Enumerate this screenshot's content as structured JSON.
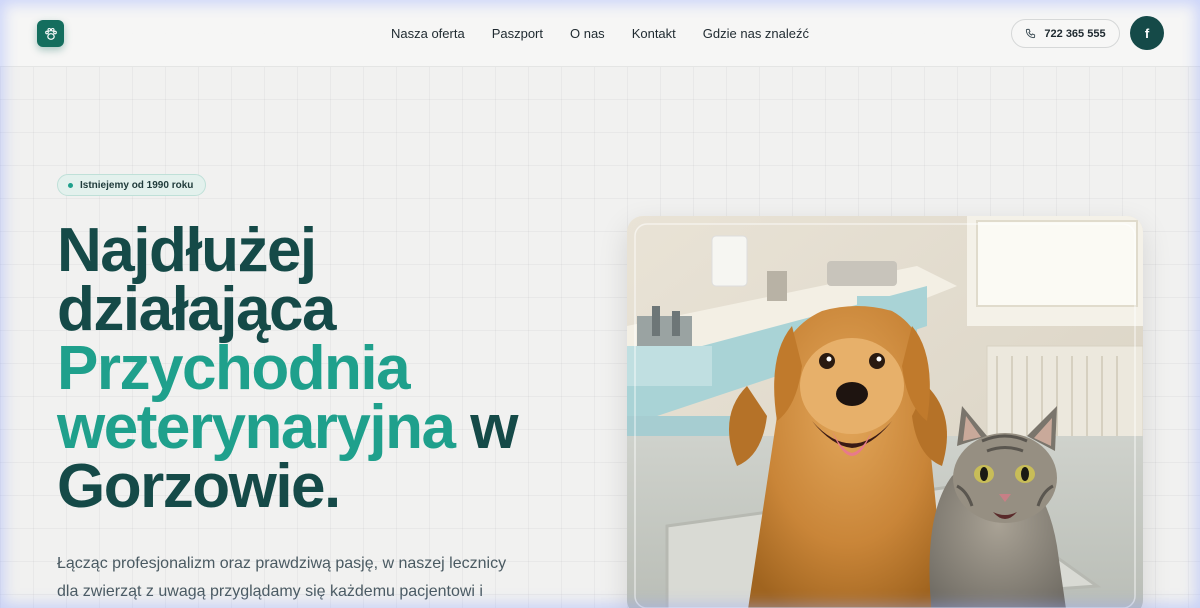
{
  "header": {
    "nav": [
      "Nasza oferta",
      "Paszport",
      "O nas",
      "Kontakt",
      "Gdzie nas znaleźć"
    ],
    "phone": "722 365 555",
    "facebook_icon": "f"
  },
  "hero": {
    "badge": "Istniejemy od 1990 roku",
    "title_part1": "Najdłużej działająca",
    "title_accent": "Przychodnia weterynaryjna",
    "title_part2": " w Gorzowie.",
    "lead": "Łącząc profesjonalizm oraz prawdziwą pasję, w naszej lecznicy dla zwierząt z uwagą przyglądamy się każdemu pacjentowi i staramy się mu pomóc."
  },
  "colors": {
    "brand_dark": "#154a48",
    "brand_accent": "#1fa08c",
    "logo_bg": "#146e5e"
  },
  "icons": {
    "logo": "paw-icon",
    "phone": "phone-icon",
    "facebook": "facebook-icon"
  }
}
